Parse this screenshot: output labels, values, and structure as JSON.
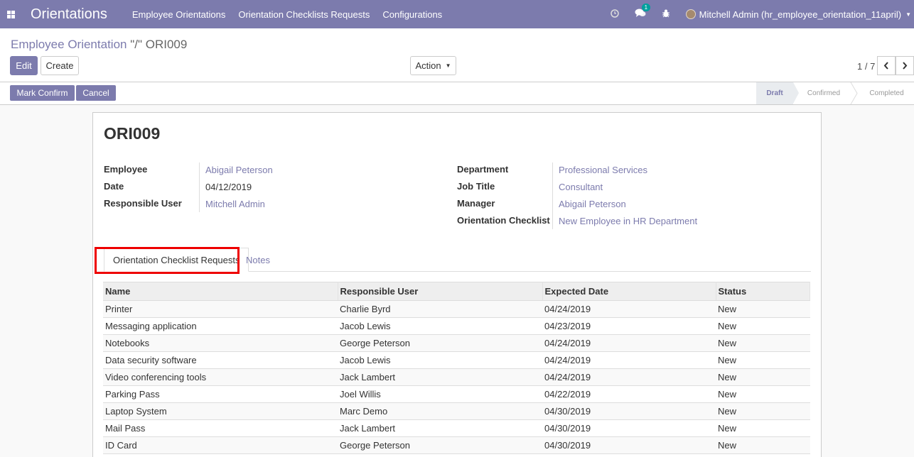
{
  "navbar": {
    "brand": "Orientations",
    "menu": [
      "Employee Orientations",
      "Orientation Checklists Requests",
      "Configurations"
    ],
    "chat_badge": "1",
    "user": "Mitchell Admin (hr_employee_orientation_11april)"
  },
  "breadcrumb": {
    "parent": "Employee Orientation",
    "separator": " \"/\" ",
    "current": "ORI009"
  },
  "buttons": {
    "edit": "Edit",
    "create": "Create",
    "action": "Action",
    "mark_confirm": "Mark Confirm",
    "cancel": "Cancel"
  },
  "pager": {
    "value": "1 / 7"
  },
  "stages": [
    "Draft",
    "Confirmed",
    "Completed"
  ],
  "current_stage": "Draft",
  "record": {
    "title": "ORI009",
    "left_fields": [
      {
        "label": "Employee",
        "value": "Abigail Peterson"
      },
      {
        "label": "Date",
        "value": "04/12/2019"
      },
      {
        "label": "Responsible User",
        "value": "Mitchell Admin"
      }
    ],
    "right_fields": [
      {
        "label": "Department",
        "value": "Professional Services"
      },
      {
        "label": "Job Title",
        "value": "Consultant"
      },
      {
        "label": "Manager",
        "value": "Abigail Peterson"
      },
      {
        "label": "Orientation Checklist",
        "value": "New Employee in HR Department"
      }
    ]
  },
  "tabs": [
    "Orientation Checklist Requests",
    "Notes"
  ],
  "table": {
    "headers": [
      "Name",
      "Responsible User",
      "Expected Date",
      "Status"
    ],
    "rows": [
      [
        "Printer",
        "Charlie Byrd",
        "04/24/2019",
        "New"
      ],
      [
        "Messaging application",
        "Jacob Lewis",
        "04/23/2019",
        "New"
      ],
      [
        "Notebooks",
        "George Peterson",
        "04/24/2019",
        "New"
      ],
      [
        "Data security software",
        "Jacob Lewis",
        "04/24/2019",
        "New"
      ],
      [
        "Video conferencing tools",
        "Jack Lambert",
        "04/24/2019",
        "New"
      ],
      [
        "Parking Pass",
        "Joel Willis",
        "04/22/2019",
        "New"
      ],
      [
        "Laptop System",
        "Marc Demo",
        "04/30/2019",
        "New"
      ],
      [
        "Mail Pass",
        "Jack Lambert",
        "04/30/2019",
        "New"
      ],
      [
        "ID Card",
        "George Peterson",
        "04/30/2019",
        "New"
      ]
    ]
  }
}
